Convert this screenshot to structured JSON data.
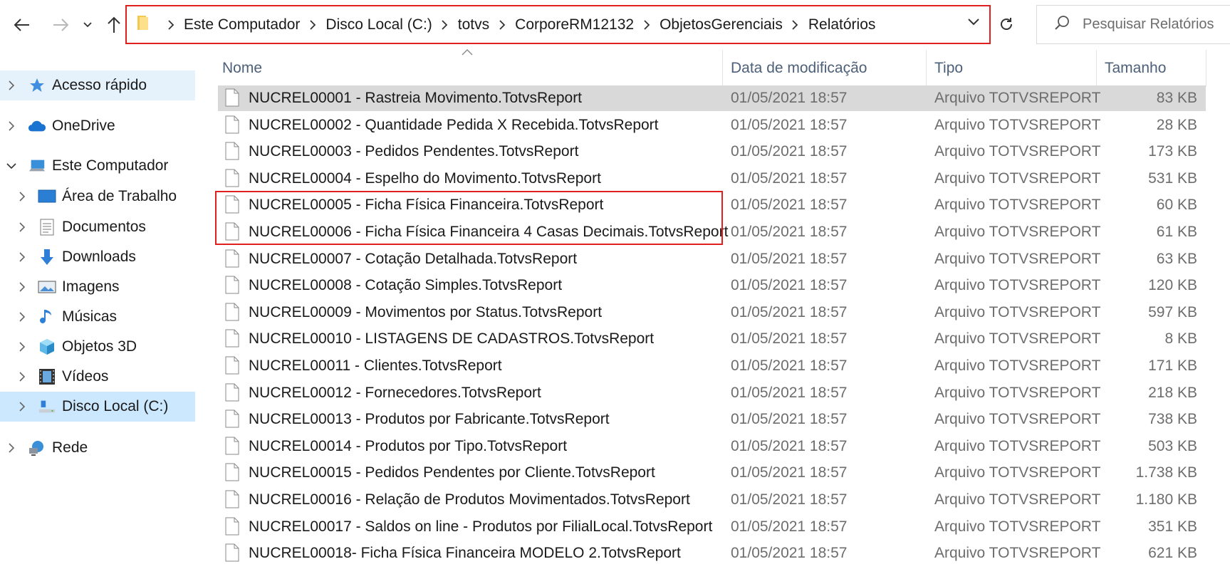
{
  "address_bar": {
    "crumbs": [
      "Este Computador",
      "Disco Local (C:)",
      "totvs",
      "CorporeRM12132",
      "ObjetosGerenciais",
      "Relatórios"
    ]
  },
  "search": {
    "placeholder": "Pesquisar Relatórios"
  },
  "sidebar": {
    "items": [
      {
        "label": "Acesso rápido",
        "icon": "star-icon"
      },
      {
        "label": "OneDrive",
        "icon": "cloud-icon"
      },
      {
        "label": "Este Computador",
        "icon": "computer-icon"
      },
      {
        "label": "Área de Trabalho",
        "icon": "desktop-icon"
      },
      {
        "label": "Documentos",
        "icon": "documents-icon"
      },
      {
        "label": "Downloads",
        "icon": "download-icon"
      },
      {
        "label": "Imagens",
        "icon": "pictures-icon"
      },
      {
        "label": "Músicas",
        "icon": "music-icon"
      },
      {
        "label": "Objetos 3D",
        "icon": "cube-icon"
      },
      {
        "label": "Vídeos",
        "icon": "video-icon"
      },
      {
        "label": "Disco Local (C:)",
        "icon": "drive-icon"
      },
      {
        "label": "Rede",
        "icon": "network-icon"
      }
    ]
  },
  "columns": {
    "name": "Nome",
    "date": "Data de modificação",
    "type": "Tipo",
    "size": "Tamanho"
  },
  "files": [
    {
      "name": "NUCREL00001 - Rastreia Movimento.TotvsReport",
      "date": "01/05/2021 18:57",
      "type": "Arquivo TOTVSREPORT",
      "size": "83 KB"
    },
    {
      "name": "NUCREL00002 - Quantidade Pedida X Recebida.TotvsReport",
      "date": "01/05/2021 18:57",
      "type": "Arquivo TOTVSREPORT",
      "size": "28 KB"
    },
    {
      "name": "NUCREL00003 - Pedidos Pendentes.TotvsReport",
      "date": "01/05/2021 18:57",
      "type": "Arquivo TOTVSREPORT",
      "size": "173 KB"
    },
    {
      "name": "NUCREL00004 - Espelho do Movimento.TotvsReport",
      "date": "01/05/2021 18:57",
      "type": "Arquivo TOTVSREPORT",
      "size": "531 KB"
    },
    {
      "name": "NUCREL00005 - Ficha Física Financeira.TotvsReport",
      "date": "01/05/2021 18:57",
      "type": "Arquivo TOTVSREPORT",
      "size": "60 KB"
    },
    {
      "name": "NUCREL00006 - Ficha Física Financeira 4 Casas Decimais.TotvsReport",
      "date": "01/05/2021 18:57",
      "type": "Arquivo TOTVSREPORT",
      "size": "61 KB"
    },
    {
      "name": "NUCREL00007 - Cotação Detalhada.TotvsReport",
      "date": "01/05/2021 18:57",
      "type": "Arquivo TOTVSREPORT",
      "size": "63 KB"
    },
    {
      "name": "NUCREL00008 - Cotação Simples.TotvsReport",
      "date": "01/05/2021 18:57",
      "type": "Arquivo TOTVSREPORT",
      "size": "120 KB"
    },
    {
      "name": "NUCREL00009 - Movimentos por Status.TotvsReport",
      "date": "01/05/2021 18:57",
      "type": "Arquivo TOTVSREPORT",
      "size": "597 KB"
    },
    {
      "name": "NUCREL00010 - LISTAGENS DE CADASTROS.TotvsReport",
      "date": "01/05/2021 18:57",
      "type": "Arquivo TOTVSREPORT",
      "size": "8 KB"
    },
    {
      "name": "NUCREL00011 - Clientes.TotvsReport",
      "date": "01/05/2021 18:57",
      "type": "Arquivo TOTVSREPORT",
      "size": "171 KB"
    },
    {
      "name": "NUCREL00012 - Fornecedores.TotvsReport",
      "date": "01/05/2021 18:57",
      "type": "Arquivo TOTVSREPORT",
      "size": "218 KB"
    },
    {
      "name": "NUCREL00013 - Produtos por Fabricante.TotvsReport",
      "date": "01/05/2021 18:57",
      "type": "Arquivo TOTVSREPORT",
      "size": "738 KB"
    },
    {
      "name": "NUCREL00014 - Produtos por Tipo.TotvsReport",
      "date": "01/05/2021 18:57",
      "type": "Arquivo TOTVSREPORT",
      "size": "503 KB"
    },
    {
      "name": "NUCREL00015 - Pedidos Pendentes por Cliente.TotvsReport",
      "date": "01/05/2021 18:57",
      "type": "Arquivo TOTVSREPORT",
      "size": "1.738 KB"
    },
    {
      "name": "NUCREL00016 - Relação de Produtos Movimentados.TotvsReport",
      "date": "01/05/2021 18:57",
      "type": "Arquivo TOTVSREPORT",
      "size": "1.180 KB"
    },
    {
      "name": "NUCREL00017 - Saldos on line - Produtos por FilialLocal.TotvsReport",
      "date": "01/05/2021 18:57",
      "type": "Arquivo TOTVSREPORT",
      "size": "351 KB"
    },
    {
      "name": "NUCREL00018- Ficha Física Financeira MODELO 2.TotvsReport",
      "date": "01/05/2021 18:57",
      "type": "Arquivo TOTVSREPORT",
      "size": "621 KB"
    }
  ],
  "colors": {
    "highlight_border": "#e01f1f",
    "selected_row": "#d9d9d9",
    "selected_nav": "#cce8ff"
  }
}
